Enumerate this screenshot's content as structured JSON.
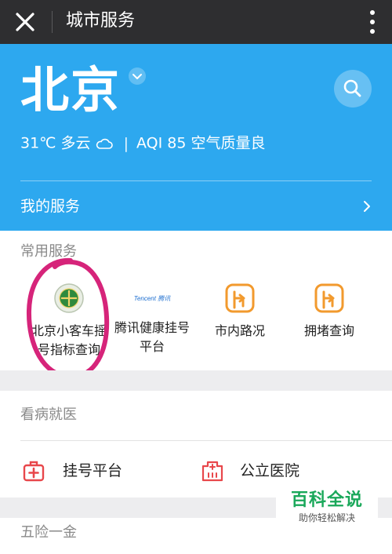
{
  "topbar": {
    "title": "城市服务"
  },
  "header": {
    "city": "北京",
    "weather": {
      "temp": "31℃ 多云",
      "aqi": "AQI 85 空气质量良"
    },
    "my_services": "我的服务"
  },
  "common": {
    "title": "常用服务",
    "items": [
      {
        "label_line1": "北京小客车摇",
        "label_line2": "号指标查询",
        "icon": "beijing-emblem-icon"
      },
      {
        "label_line1": "腾讯健康挂号",
        "label_line2": "平台",
        "icon": "tencent-logo-icon",
        "logo_text": "Tencent 腾讯"
      },
      {
        "label_line1": "市内路况",
        "label_line2": "",
        "icon": "road-sign-icon"
      },
      {
        "label_line1": "拥堵查询",
        "label_line2": "",
        "icon": "road-sign-icon"
      }
    ]
  },
  "medical": {
    "title": "看病就医",
    "items": [
      {
        "label": "挂号平台",
        "icon": "first-aid-kit-icon"
      },
      {
        "label": "公立医院",
        "icon": "hospital-icon"
      }
    ]
  },
  "insurance": {
    "title": "五险一金"
  },
  "watermark": {
    "title": "百科全说",
    "subtitle": "助你轻松解决"
  },
  "colors": {
    "header_blue": "#2da8ef",
    "topbar_dark": "#2e2e30",
    "road_orange": "#f29a2e",
    "medical_red": "#e8474b",
    "annotation_pink": "#d6247a",
    "watermark_green": "#1aa85a"
  }
}
